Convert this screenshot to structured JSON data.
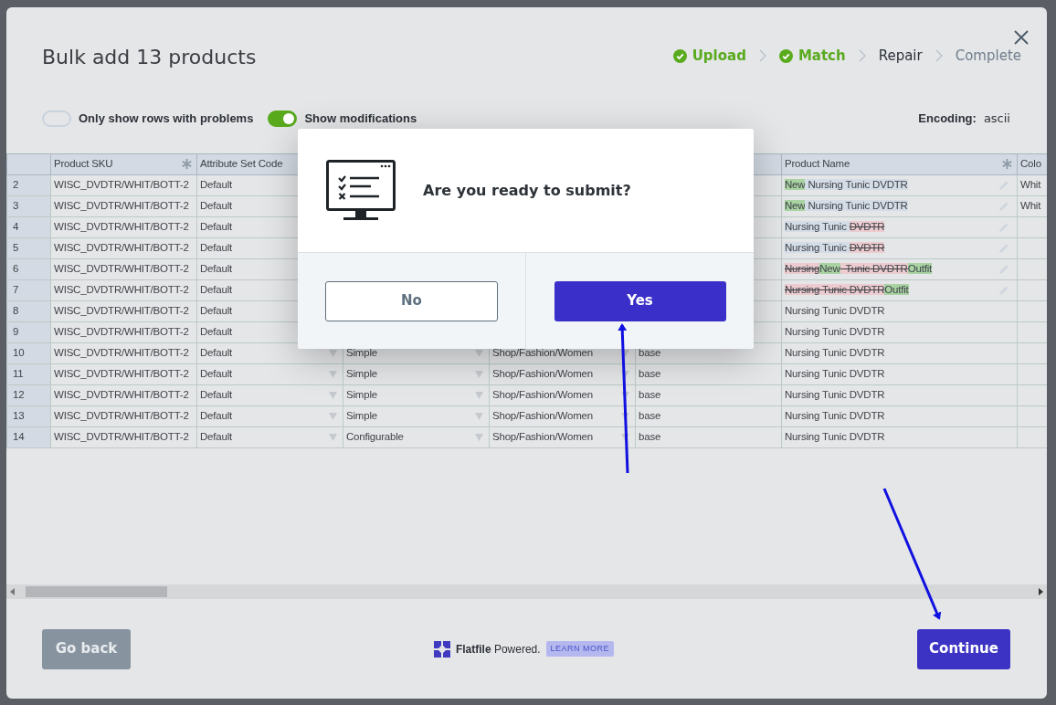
{
  "modal": {
    "title": "Bulk add 13 products"
  },
  "steps": [
    {
      "label": "Upload",
      "completed": true,
      "active": false
    },
    {
      "label": "Match",
      "completed": true,
      "active": false
    },
    {
      "label": "Repair",
      "completed": false,
      "active": true
    },
    {
      "label": "Complete",
      "completed": false,
      "active": false
    }
  ],
  "toggles": [
    {
      "label": "Only show rows with problems",
      "on": false
    },
    {
      "label": "Show modifications",
      "on": true
    }
  ],
  "encoding": {
    "label": "Encoding:",
    "value": "ascii"
  },
  "table": {
    "columns": [
      {
        "kind": "label",
        "label": "Product SKU",
        "required": true
      },
      {
        "kind": "label",
        "label": "Attribute Set Code",
        "required": false
      },
      {
        "kind": "blank"
      },
      {
        "kind": "blank"
      },
      {
        "kind": "blank"
      },
      {
        "kind": "label",
        "label": "Product Name",
        "required": true
      },
      {
        "kind": "label",
        "label": "Colo",
        "required": false
      }
    ],
    "rows": [
      {
        "number": "2",
        "cells": [
          {
            "kind": "text",
            "value": "WISC_DVDTR/WHIT/BOTT-2"
          },
          {
            "kind": "text",
            "value": "Default"
          },
          {
            "kind": "blank"
          },
          {
            "kind": "blank"
          },
          {
            "kind": "blank"
          },
          {
            "kind": "diff",
            "segments": [
              {
                "kind": "added",
                "text": "New"
              },
              {
                "kind": "kept",
                "text": " Nursing Tunic DVDTR"
              }
            ]
          },
          {
            "kind": "text",
            "value": "Whit"
          }
        ]
      },
      {
        "number": "3",
        "cells": [
          {
            "kind": "text",
            "value": "WISC_DVDTR/WHIT/BOTT-2"
          },
          {
            "kind": "text",
            "value": "Default"
          },
          {
            "kind": "blank"
          },
          {
            "kind": "blank"
          },
          {
            "kind": "blank"
          },
          {
            "kind": "diff",
            "segments": [
              {
                "kind": "added",
                "text": "New"
              },
              {
                "kind": "kept",
                "text": " Nursing Tunic DVDTR"
              }
            ]
          },
          {
            "kind": "text",
            "value": "Whit"
          }
        ]
      },
      {
        "number": "4",
        "cells": [
          {
            "kind": "text",
            "value": "WISC_DVDTR/WHIT/BOTT-2"
          },
          {
            "kind": "text",
            "value": "Default"
          },
          {
            "kind": "blank"
          },
          {
            "kind": "blank"
          },
          {
            "kind": "blank"
          },
          {
            "kind": "diff",
            "segments": [
              {
                "kind": "kept",
                "text": "Nursing Tunic "
              },
              {
                "kind": "removed",
                "text": "DVDTR"
              }
            ]
          },
          {
            "kind": "blank"
          }
        ]
      },
      {
        "number": "5",
        "cells": [
          {
            "kind": "text",
            "value": "WISC_DVDTR/WHIT/BOTT-2"
          },
          {
            "kind": "text",
            "value": "Default"
          },
          {
            "kind": "blank"
          },
          {
            "kind": "blank"
          },
          {
            "kind": "blank"
          },
          {
            "kind": "diff",
            "segments": [
              {
                "kind": "kept",
                "text": "Nursing Tunic "
              },
              {
                "kind": "removed",
                "text": "DVDTR"
              }
            ]
          },
          {
            "kind": "blank"
          }
        ]
      },
      {
        "number": "6",
        "cells": [
          {
            "kind": "text",
            "value": "WISC_DVDTR/WHIT/BOTT-2"
          },
          {
            "kind": "text",
            "value": "Default"
          },
          {
            "kind": "blank"
          },
          {
            "kind": "blank"
          },
          {
            "kind": "blank"
          },
          {
            "kind": "diff",
            "segments": [
              {
                "kind": "removed",
                "text": "Nursing"
              },
              {
                "kind": "added",
                "text": "New"
              },
              {
                "kind": "removed",
                "text": "  Tunic DVDTR"
              },
              {
                "kind": "added",
                "text": "Outfit"
              }
            ]
          },
          {
            "kind": "blank"
          }
        ]
      },
      {
        "number": "7",
        "cells": [
          {
            "kind": "text",
            "value": "WISC_DVDTR/WHIT/BOTT-2"
          },
          {
            "kind": "text",
            "value": "Default"
          },
          {
            "kind": "blank"
          },
          {
            "kind": "blank"
          },
          {
            "kind": "blank"
          },
          {
            "kind": "diff",
            "segments": [
              {
                "kind": "removed",
                "text": "Nursing Tunic DVDTR"
              },
              {
                "kind": "added",
                "text": "Outfit"
              }
            ]
          },
          {
            "kind": "blank"
          }
        ]
      },
      {
        "number": "8",
        "cells": [
          {
            "kind": "text",
            "value": "WISC_DVDTR/WHIT/BOTT-2"
          },
          {
            "kind": "text",
            "value": "Default"
          },
          {
            "kind": "blank"
          },
          {
            "kind": "blank"
          },
          {
            "kind": "blank"
          },
          {
            "kind": "text",
            "value": "Nursing Tunic DVDTR"
          },
          {
            "kind": "blank"
          }
        ]
      },
      {
        "number": "9",
        "cells": [
          {
            "kind": "text",
            "value": "WISC_DVDTR/WHIT/BOTT-2"
          },
          {
            "kind": "text",
            "value": "Default"
          },
          {
            "kind": "blank"
          },
          {
            "kind": "blank"
          },
          {
            "kind": "blank"
          },
          {
            "kind": "text",
            "value": "Nursing Tunic DVDTR"
          },
          {
            "kind": "blank"
          }
        ]
      },
      {
        "number": "10",
        "cells": [
          {
            "kind": "text",
            "value": "WISC_DVDTR/WHIT/BOTT-2"
          },
          {
            "kind": "select",
            "value": "Default"
          },
          {
            "kind": "select",
            "value": "Simple"
          },
          {
            "kind": "select",
            "value": "Shop/Fashion/Women"
          },
          {
            "kind": "text",
            "value": "base"
          },
          {
            "kind": "text",
            "value": "Nursing Tunic DVDTR"
          },
          {
            "kind": "blank"
          }
        ]
      },
      {
        "number": "11",
        "cells": [
          {
            "kind": "text",
            "value": "WISC_DVDTR/WHIT/BOTT-2"
          },
          {
            "kind": "select",
            "value": "Default"
          },
          {
            "kind": "select",
            "value": "Simple"
          },
          {
            "kind": "select",
            "value": "Shop/Fashion/Women"
          },
          {
            "kind": "text",
            "value": "base"
          },
          {
            "kind": "text",
            "value": "Nursing Tunic DVDTR"
          },
          {
            "kind": "blank"
          }
        ]
      },
      {
        "number": "12",
        "cells": [
          {
            "kind": "text",
            "value": "WISC_DVDTR/WHIT/BOTT-2"
          },
          {
            "kind": "select",
            "value": "Default"
          },
          {
            "kind": "select",
            "value": "Simple"
          },
          {
            "kind": "select",
            "value": "Shop/Fashion/Women"
          },
          {
            "kind": "text",
            "value": "base"
          },
          {
            "kind": "text",
            "value": "Nursing Tunic DVDTR"
          },
          {
            "kind": "blank"
          }
        ]
      },
      {
        "number": "13",
        "cells": [
          {
            "kind": "text",
            "value": "WISC_DVDTR/WHIT/BOTT-2"
          },
          {
            "kind": "select",
            "value": "Default"
          },
          {
            "kind": "select",
            "value": "Simple"
          },
          {
            "kind": "select",
            "value": "Shop/Fashion/Women"
          },
          {
            "kind": "text",
            "value": "base"
          },
          {
            "kind": "text",
            "value": "Nursing Tunic DVDTR"
          },
          {
            "kind": "blank"
          }
        ]
      },
      {
        "number": "14",
        "cells": [
          {
            "kind": "text",
            "value": "WISC_DVDTR/WHIT/BOTT-2"
          },
          {
            "kind": "select",
            "value": "Default"
          },
          {
            "kind": "select",
            "value": "Configurable"
          },
          {
            "kind": "select",
            "value": "Shop/Fashion/Women"
          },
          {
            "kind": "text",
            "value": "base"
          },
          {
            "kind": "text",
            "value": "Nursing Tunic DVDTR"
          },
          {
            "kind": "blank"
          }
        ]
      }
    ]
  },
  "dialog": {
    "question": "Are you ready to submit?",
    "buttons": [
      {
        "label": "No",
        "kind": "secondary"
      },
      {
        "label": "Yes",
        "kind": "primary"
      }
    ]
  },
  "footer": {
    "back": {
      "label": "Go back",
      "disabled": true
    },
    "branding": "**Flatfile** Powered.",
    "learn_more": "LEARN MORE",
    "continue": {
      "label": "Continue"
    }
  }
}
